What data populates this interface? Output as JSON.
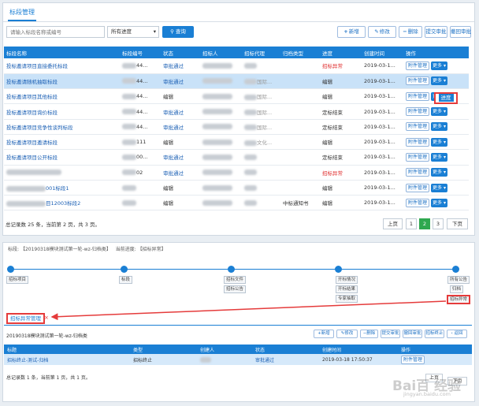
{
  "panel1": {
    "tab": "标段管理",
    "search": {
      "placeholder": "请输入标段名称或编号",
      "select_value": "所有进度",
      "button": "查询"
    },
    "toolbar": [
      {
        "icon": "+",
        "label": "新增"
      },
      {
        "icon": "✎",
        "label": "修改"
      },
      {
        "icon": "−",
        "label": "删除"
      },
      {
        "icon": "",
        "label": "提交审批"
      },
      {
        "icon": "",
        "label": "撤回审批"
      }
    ],
    "columns": [
      "标段名称",
      "标段编号",
      "状态",
      "招标人",
      "招标代理",
      "归档类型",
      "进度",
      "创建时间",
      "操作"
    ],
    "rows": [
      {
        "name": "投标邀请项目直接委托标段",
        "code": "44...",
        "status": "审批通过",
        "agent": "",
        "archive": "",
        "progress": "招标异常",
        "time": "2019-03-1..."
      },
      {
        "name": "投标邀请随机抽取标段",
        "code": "44...",
        "status": "审批通过",
        "agent": "国际...",
        "archive": "",
        "progress": "编辑",
        "time": "2019-03-1..."
      },
      {
        "name": "投标邀请项目其他标段",
        "code": "44...",
        "status": "编辑",
        "agent": "国际...",
        "archive": "",
        "progress": "编辑",
        "time": "2019-03-1..."
      },
      {
        "name": "投标邀请项目询价标段",
        "code": "44...",
        "status": "审批通过",
        "agent": "国际...",
        "archive": "",
        "progress": "定标结束",
        "time": "2019-03-1..."
      },
      {
        "name": "投标邀请项目竞争性谈判标段",
        "code": "44...",
        "status": "审批通过",
        "agent": "国际...",
        "archive": "",
        "progress": "定标结束",
        "time": "2019-03-1..."
      },
      {
        "name": "投标邀请项目邀请标段",
        "code": "111",
        "status": "编辑",
        "agent": "文化...",
        "archive": "",
        "progress": "编辑",
        "time": "2019-03-1..."
      },
      {
        "name": "投标邀请项目公开标段",
        "code": "00...",
        "status": "审批通过",
        "agent": "",
        "archive": "",
        "progress": "定标结束",
        "time": "2019-03-1..."
      },
      {
        "name": "",
        "code": "02",
        "status": "审批通过",
        "agent": "",
        "archive": "",
        "progress": "招标异常",
        "time": "2019-03-1..."
      },
      {
        "name": "001标段1",
        "code": "",
        "status": "编辑",
        "agent": "",
        "archive": "",
        "progress": "编辑",
        "time": "2019-03-1..."
      },
      {
        "name": "目12003标段2",
        "code": "",
        "status": "编辑",
        "agent": "",
        "archive": "中标通知书",
        "progress": "编辑",
        "time": "2019-03-1..."
      }
    ],
    "row_actions": {
      "attach": "附件管理",
      "more": "更多"
    },
    "popup_item": "进度",
    "pager": {
      "summary": "总记录数 25 条，当前第 2 页，共 3 页。",
      "prev": "上页",
      "pages": [
        "1",
        "2",
        "3"
      ],
      "current": "2",
      "next": "下页"
    }
  },
  "panel2": {
    "info_section": "标段:",
    "info_name": "【20190318模块测试第一轮-wz-归档类】",
    "info_progress_label": "当前进度:",
    "info_progress": "【招标异常】",
    "steps": [
      [
        "招标项目"
      ],
      [
        "标段"
      ],
      [
        "招标文件",
        "招标公告"
      ],
      [
        "开标情况",
        "开标结果",
        "专家抽取"
      ],
      [
        "所有公告",
        "归档",
        "招标异常"
      ]
    ],
    "tab": "招标异常管理",
    "tab_close": "×",
    "title": "20190318模块测试第一轮-wz-归档类",
    "toolbar": [
      {
        "icon": "+",
        "label": "新增"
      },
      {
        "icon": "✎",
        "label": "修改"
      },
      {
        "icon": "−",
        "label": "删除"
      },
      {
        "icon": "",
        "label": "提交审批"
      },
      {
        "icon": "",
        "label": "撤回审批"
      },
      {
        "icon": "",
        "label": "招标终止"
      },
      {
        "icon": "‹",
        "label": "返回"
      }
    ],
    "columns": [
      "标题",
      "类型",
      "创建人",
      "状态",
      "创建时间",
      "操作"
    ],
    "row": {
      "title": "招标终止-测试-归档",
      "type": "招标终止",
      "creator": "",
      "status": "审批通过",
      "time": "2019-03-18 17:50:37",
      "action": "附件管理"
    },
    "pager": {
      "summary": "总记录数 1 条，当前第 1 页，共 1 页。",
      "prev": "上页",
      "next": "下页"
    }
  },
  "watermark": {
    "main": "Bai百 经验",
    "sub": "jingyan.baidu.com"
  },
  "colors": {
    "primary": "#1a7fd4",
    "highlight": "#e53b3b",
    "pager_active": "#2fa84f",
    "selected_row": "#c9e2f8"
  }
}
